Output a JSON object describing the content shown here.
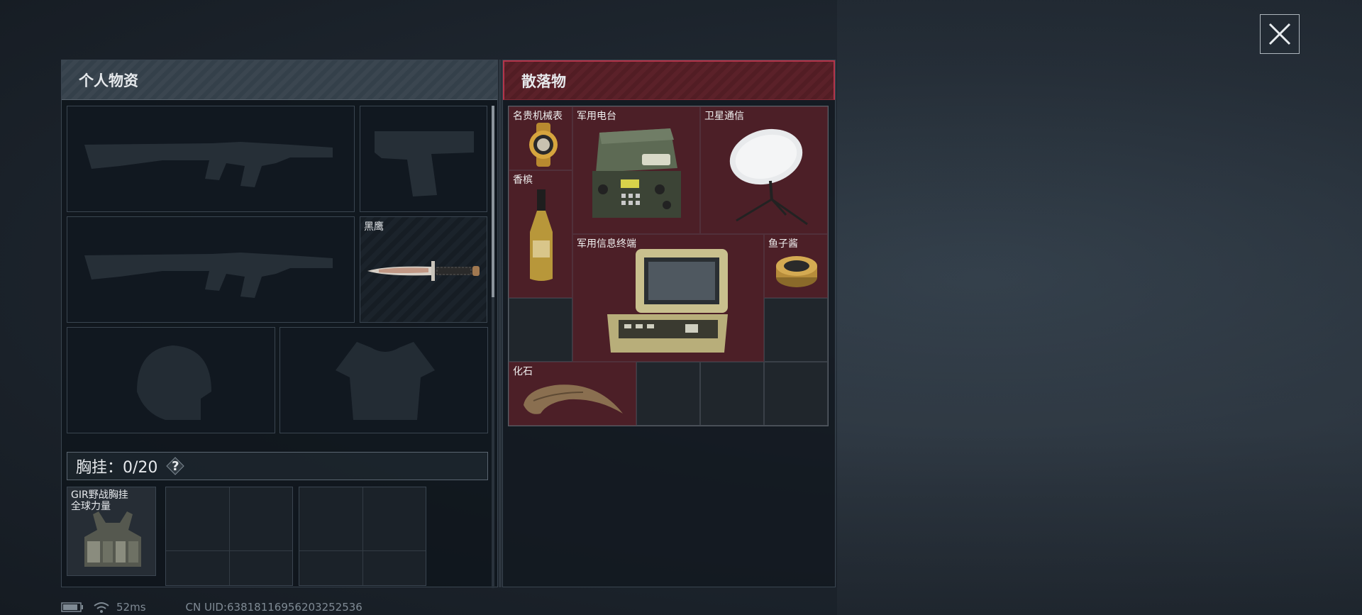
{
  "personal": {
    "title": "个人物资",
    "knife_label": "黑鹰",
    "chest_label": "胸挂：0/20",
    "help": "?",
    "vest_line1": "GIR野战胸挂",
    "vest_line2": "全球力量"
  },
  "scatter": {
    "title": "散落物",
    "items": {
      "watch": "名贵机械表",
      "radio": "军用电台",
      "satellite": "卫星通信",
      "champagne": "香槟",
      "terminal": "军用信息终端",
      "caviar": "鱼子酱",
      "fossil": "化石"
    }
  },
  "status": {
    "ping": "52ms",
    "uid": "CN UID:6381811695620325253​6"
  },
  "colors": {
    "loot_red": "#4c1f27",
    "accent_red": "#b3344a"
  }
}
